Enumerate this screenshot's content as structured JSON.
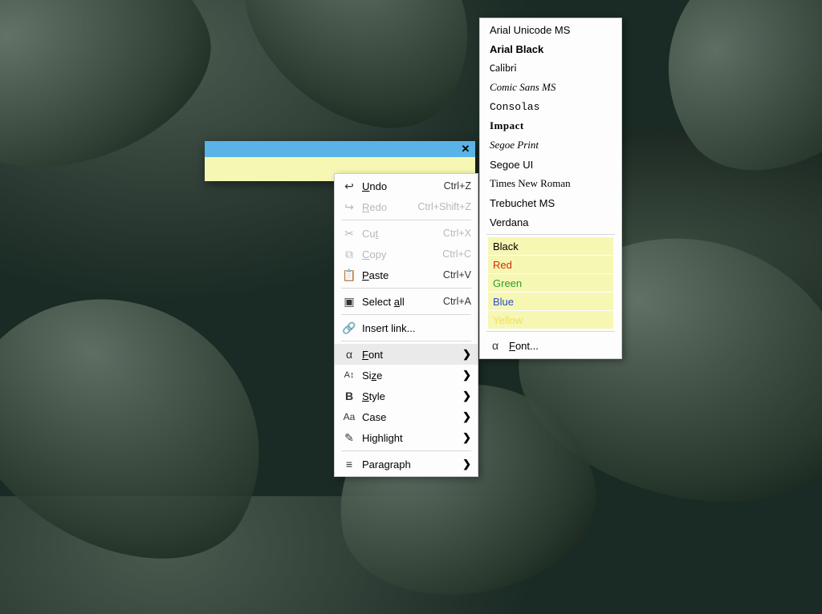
{
  "note": {
    "close": "✕"
  },
  "context_menu": {
    "undo": {
      "label": "Undo",
      "mnemonic": "U",
      "shortcut": "Ctrl+Z"
    },
    "redo": {
      "label": "Redo",
      "mnemonic": "R",
      "shortcut": "Ctrl+Shift+Z"
    },
    "cut": {
      "label": "Cut",
      "mnemonic": "t",
      "shortcut": "Ctrl+X"
    },
    "copy": {
      "label": "Copy",
      "mnemonic": "C",
      "shortcut": "Ctrl+C"
    },
    "paste": {
      "label": "Paste",
      "mnemonic": "P",
      "shortcut": "Ctrl+V"
    },
    "selall": {
      "label": "Select all",
      "mnemonic": "a",
      "shortcut": "Ctrl+A"
    },
    "link": {
      "label": "Insert link..."
    },
    "font": {
      "label": "Font",
      "mnemonic": "F"
    },
    "size": {
      "label": "Size",
      "mnemonic": "z"
    },
    "style": {
      "label": "Style",
      "mnemonic": "S"
    },
    "case": {
      "label": "Case"
    },
    "highlight": {
      "label": "Highlight"
    },
    "paragraph": {
      "label": "Paragraph"
    }
  },
  "font_menu": {
    "fonts": [
      {
        "label": "Arial Unicode MS",
        "css": "ff-arialuni"
      },
      {
        "label": "Arial Black",
        "css": "ff-arialblack"
      },
      {
        "label": "Calibri",
        "css": "ff-calibri"
      },
      {
        "label": "Comic Sans MS",
        "css": "ff-comic"
      },
      {
        "label": "Consolas",
        "css": "ff-consolas"
      },
      {
        "label": "Impact",
        "css": "ff-impact"
      },
      {
        "label": "Segoe Print",
        "css": "ff-segoeprint"
      },
      {
        "label": "Segoe UI",
        "css": "ff-segoeui"
      },
      {
        "label": "Times New Roman",
        "css": "ff-times"
      },
      {
        "label": "Trebuchet MS",
        "css": "ff-trebuchet"
      },
      {
        "label": "Verdana",
        "css": "ff-verdana"
      }
    ],
    "colors": [
      {
        "label": "Black",
        "color": "#000000"
      },
      {
        "label": "Red",
        "color": "#d42a00"
      },
      {
        "label": "Green",
        "color": "#2e9a2e"
      },
      {
        "label": "Blue",
        "color": "#2a4acf"
      },
      {
        "label": "Yellow",
        "color": "#f0e060"
      }
    ],
    "footer": {
      "label": "Font...",
      "mnemonic": "F"
    }
  }
}
